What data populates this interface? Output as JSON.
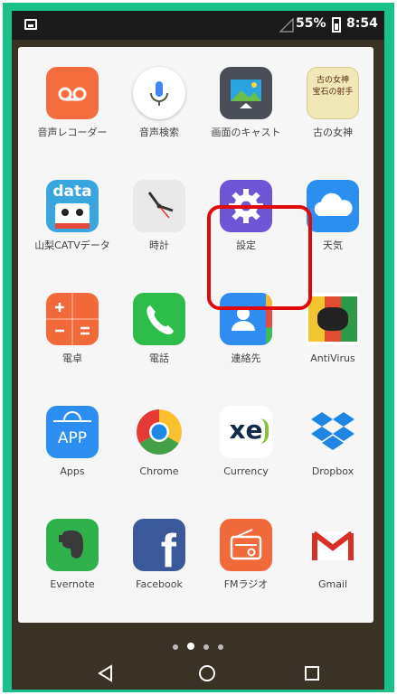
{
  "status_bar": {
    "battery": "55%",
    "time": "8:54"
  },
  "apps": [
    {
      "label": "音声レコーダー",
      "icon": "voice-recorder-icon",
      "color": "#f36c3d"
    },
    {
      "label": "音声検索",
      "icon": "voice-search-icon",
      "color": "#ffffff"
    },
    {
      "label": "画面のキャスト",
      "icon": "screen-cast-icon",
      "color": "#4a4f57"
    },
    {
      "label": "古の女神",
      "icon": "inishie-megami-icon",
      "color": "#f1e8b8",
      "icon_text": "古の女神 宝石の射手"
    },
    {
      "label": "山梨CATVデータ",
      "icon": "yamanashi-catv-data-icon",
      "color": "#3aa6e0",
      "icon_text": "data"
    },
    {
      "label": "時計",
      "icon": "clock-icon",
      "color": "#e9e9e9"
    },
    {
      "label": "設定",
      "icon": "gear-icon",
      "color": "#6e55d6"
    },
    {
      "label": "天気",
      "icon": "weather-icon",
      "color": "#2b8ff0"
    },
    {
      "label": "電卓",
      "icon": "calculator-icon",
      "color": "#f26a3a"
    },
    {
      "label": "電話",
      "icon": "phone-icon",
      "color": "#2cbd4a"
    },
    {
      "label": "連絡先",
      "icon": "contacts-icon",
      "color": "#2f8cf0"
    },
    {
      "label": "AntiVirus",
      "icon": "avg-antivirus-icon",
      "color": "#d6402b"
    },
    {
      "label": "Apps",
      "icon": "apps-store-icon",
      "color": "#2d8ef2",
      "icon_text": "APP"
    },
    {
      "label": "Chrome",
      "icon": "chrome-icon",
      "color": "#ffffff"
    },
    {
      "label": "Currency",
      "icon": "xe-currency-icon",
      "color": "#ffffff",
      "icon_text": "xe"
    },
    {
      "label": "Dropbox",
      "icon": "dropbox-icon",
      "color": "#ffffff"
    },
    {
      "label": "Evernote",
      "icon": "evernote-icon",
      "color": "#2fb24c"
    },
    {
      "label": "Facebook",
      "icon": "facebook-icon",
      "color": "#3b5998",
      "icon_text": "f"
    },
    {
      "label": "FMラジオ",
      "icon": "fm-radio-icon",
      "color": "#f26a3a"
    },
    {
      "label": "Gmail",
      "icon": "gmail-icon",
      "color": "#ffffff"
    }
  ],
  "pages": {
    "count": 4,
    "current": 2
  },
  "colors": {
    "highlight": "#e10a0a",
    "frame": "#19c08a"
  }
}
